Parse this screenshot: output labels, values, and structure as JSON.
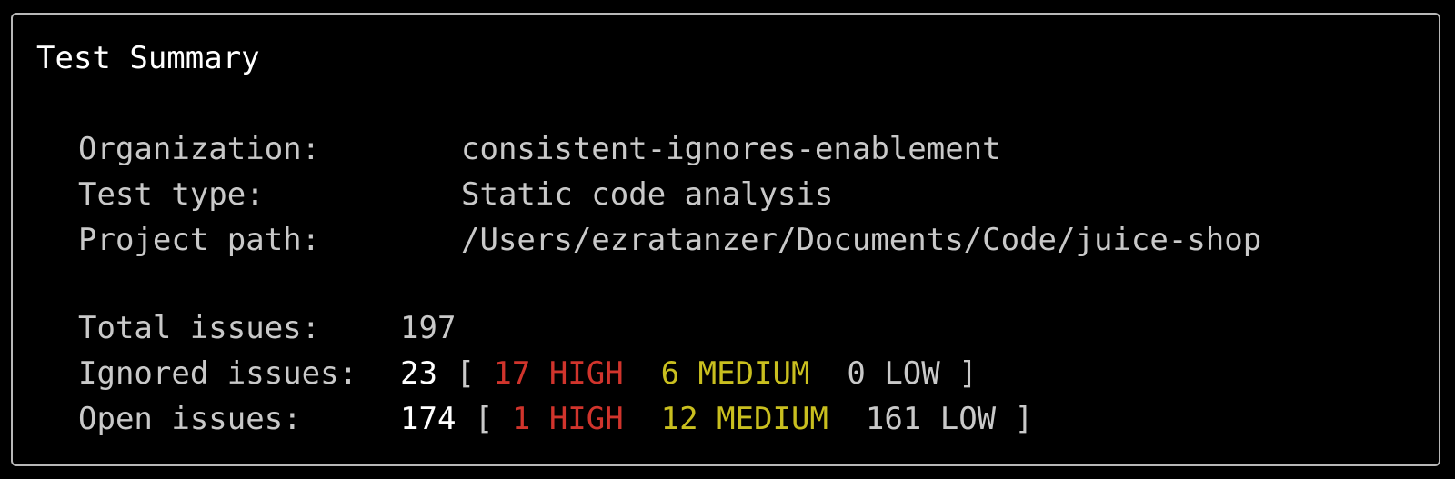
{
  "title": "Test Summary",
  "details": {
    "organization": {
      "label": "Organization:",
      "value": "consistent-ignores-enablement"
    },
    "test_type": {
      "label": "Test type:",
      "value": "Static code analysis"
    },
    "project_path": {
      "label": "Project path:",
      "value": "/Users/ezratanzer/Documents/Code/juice-shop"
    }
  },
  "issues": {
    "total": {
      "label": "Total issues:",
      "count": "197"
    },
    "ignored": {
      "label": "Ignored issues:",
      "count": "23",
      "open_bracket": "[",
      "high": "17 HIGH",
      "medium": "6 MEDIUM",
      "low": "0 LOW",
      "close_bracket": "]"
    },
    "open": {
      "label": "Open issues:",
      "count": "174",
      "open_bracket": "[",
      "high": "1 HIGH",
      "medium": "12 MEDIUM",
      "low": "161 LOW",
      "close_bracket": "]"
    }
  },
  "colors": {
    "background": "#000000",
    "text": "#c9c9c9",
    "emphasis": "#ffffff",
    "high": "#d0342c",
    "medium": "#c9bf1f",
    "border": "#b8b8b8"
  }
}
